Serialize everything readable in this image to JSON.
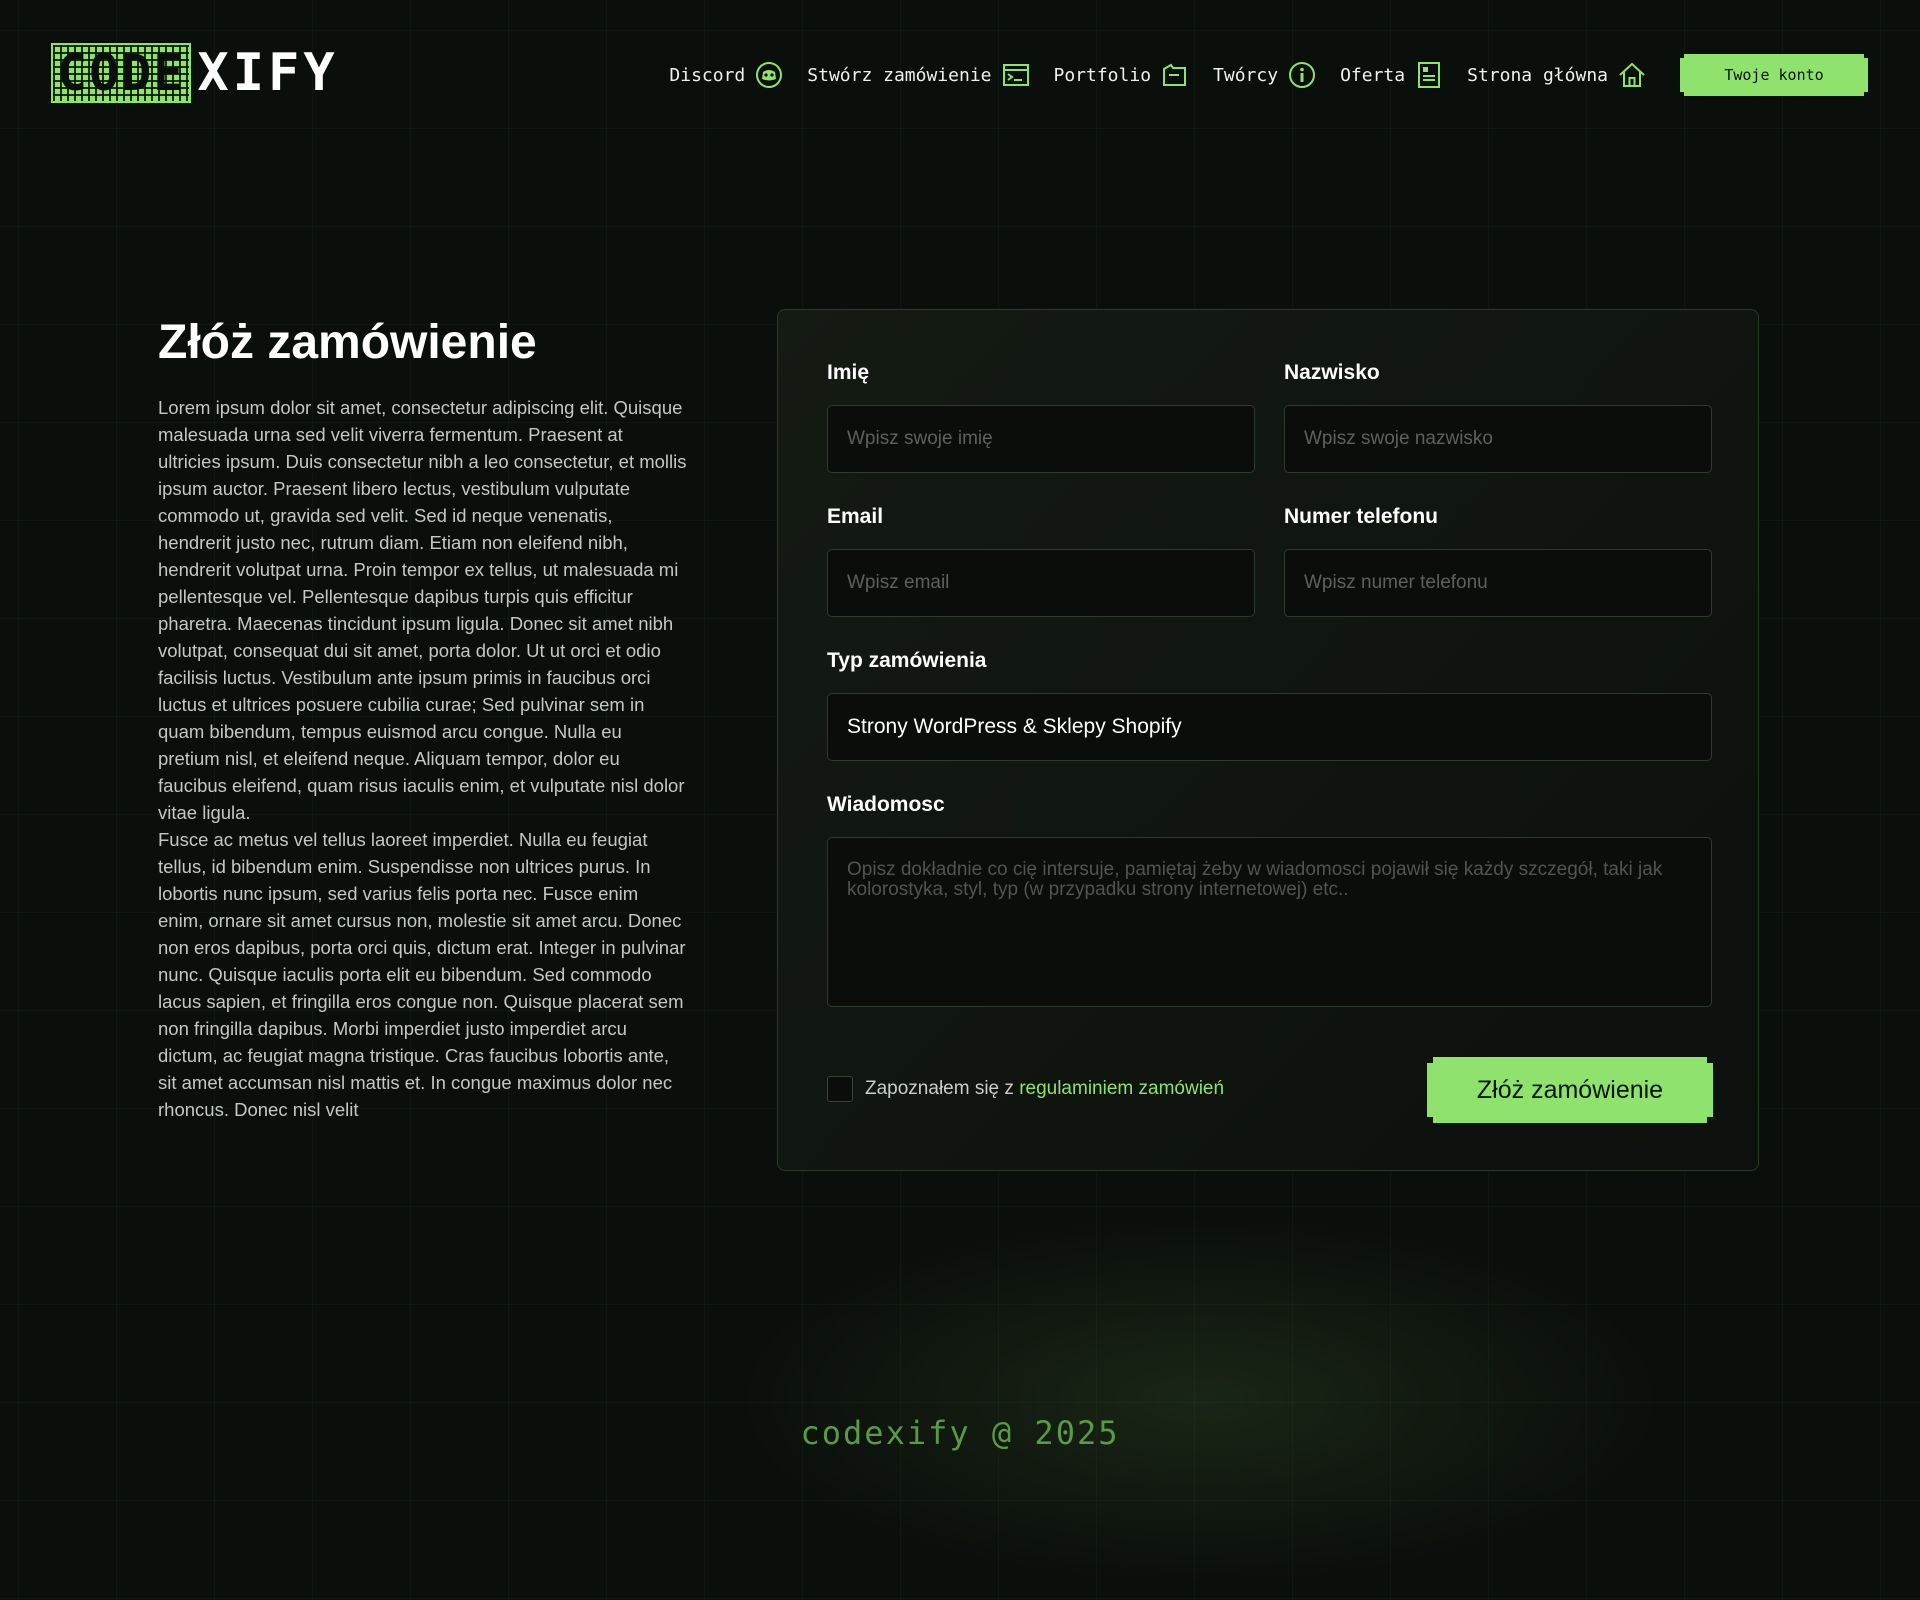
{
  "brand": {
    "logo_part1": "CODE",
    "logo_part2": "XIFY",
    "accent_color": "#8fe26d"
  },
  "nav": {
    "items": [
      {
        "label": "Discord",
        "icon": "discord-icon"
      },
      {
        "label": "Stwórz zamówienie",
        "icon": "terminal-window-icon"
      },
      {
        "label": "Portfolio",
        "icon": "folder-icon"
      },
      {
        "label": "Twórcy",
        "icon": "info-icon"
      },
      {
        "label": "Oferta",
        "icon": "document-icon"
      },
      {
        "label": "Strona główna",
        "icon": "home-icon"
      }
    ],
    "account_label": "Twoje konto"
  },
  "main": {
    "title": "Złóż zamówienie",
    "paragraphs": [
      "Lorem ipsum dolor sit amet, consectetur adipiscing elit. Quisque malesuada urna sed velit viverra fermentum. Praesent at ultricies ipsum. Duis consectetur nibh a leo consectetur, et mollis ipsum auctor. Praesent libero lectus, vestibulum vulputate commodo ut, gravida sed velit. Sed id neque venenatis, hendrerit justo nec, rutrum diam. Etiam non eleifend nibh, hendrerit volutpat urna. Proin tempor ex tellus, ut malesuada mi pellentesque vel. Pellentesque dapibus turpis quis efficitur pharetra. Maecenas tincidunt ipsum ligula. Donec sit amet nibh volutpat, consequat dui sit amet, porta dolor. Ut ut orci et odio facilisis luctus. Vestibulum ante ipsum primis in faucibus orci luctus et ultrices posuere cubilia curae; Sed pulvinar sem in quam bibendum, tempus euismod arcu congue. Nulla eu pretium nisl, et eleifend neque. Aliquam tempor, dolor eu faucibus eleifend, quam risus iaculis enim, et vulputate nisl dolor vitae ligula.",
      "Fusce ac metus vel tellus laoreet imperdiet. Nulla eu feugiat tellus, id bibendum enim. Suspendisse non ultrices purus. In lobortis nunc ipsum, sed varius felis porta nec. Fusce enim enim, ornare sit amet cursus non, molestie sit amet arcu. Donec non eros dapibus, porta orci quis, dictum erat. Integer in pulvinar nunc. Quisque iaculis porta elit eu bibendum. Sed commodo lacus sapien, et fringilla eros congue non. Quisque placerat sem non fringilla dapibus. Morbi imperdiet justo imperdiet arcu dictum, ac feugiat magna tristique. Cras faucibus lobortis ante, sit amet accumsan nisl mattis et. In congue maximus dolor nec rhoncus. Donec nisl velit"
    ]
  },
  "form": {
    "first_name": {
      "label": "Imię",
      "placeholder": "Wpisz swoje imię",
      "value": ""
    },
    "last_name": {
      "label": "Nazwisko",
      "placeholder": "Wpisz swoje nazwisko",
      "value": ""
    },
    "email": {
      "label": "Email",
      "placeholder": "Wpisz email",
      "value": ""
    },
    "phone": {
      "label": "Numer telefonu",
      "placeholder": "Wpisz numer telefonu",
      "value": ""
    },
    "order_type": {
      "label": "Typ zamówienia",
      "selected": "Strony WordPress & Sklepy Shopify"
    },
    "message": {
      "label": "Wiadomosc",
      "placeholder": "Opisz dokładnie co cię intersuje, pamiętaj żeby w wiadomosci pojawił się każdy szczegół, taki jak kolorostyka, styl, typ (w przypadku strony internetowej) etc..",
      "value": ""
    },
    "terms_prefix": "Zapoznałem się z ",
    "terms_link": "regulaminiem zamówień",
    "terms_checked": false,
    "submit_label": "Złóż zamówienie"
  },
  "footer": {
    "text": "codexify @ 2025"
  }
}
